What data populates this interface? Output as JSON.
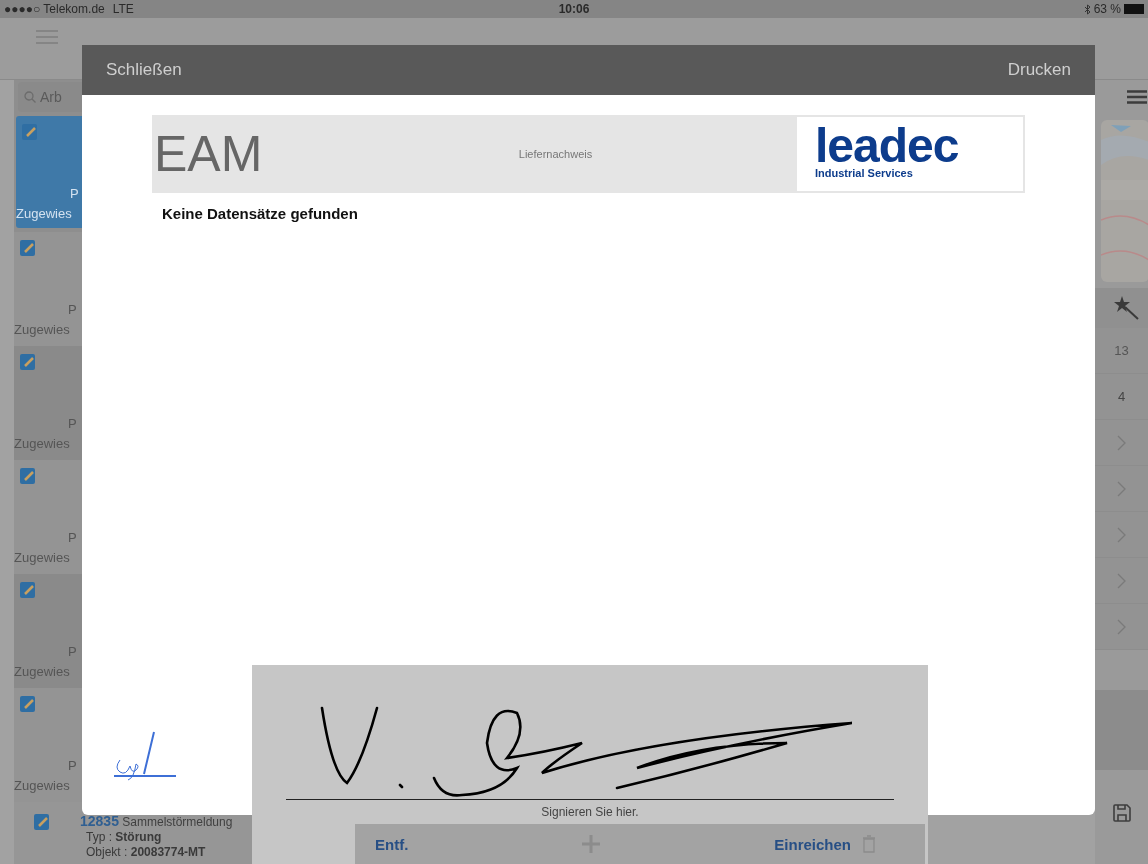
{
  "status_bar": {
    "carrier": "●●●●○ Telekom.de",
    "network": "LTE",
    "time": "10:06",
    "battery": "63 %"
  },
  "list": {
    "search_placeholder": "Arb",
    "items": [
      {
        "line_1": "P",
        "line_2": "Zugewies",
        "selected": true
      },
      {
        "line_1": "P",
        "line_2": "Zugewies",
        "selected": false
      },
      {
        "line_1": "P",
        "line_2": "Zugewies",
        "selected": false
      },
      {
        "line_1": "P",
        "line_2": "Zugewies",
        "selected": false
      },
      {
        "line_1": "P",
        "line_2": "Zugewies",
        "selected": false
      },
      {
        "line_1": "P",
        "line_2": "Zugewies",
        "selected": false
      }
    ],
    "last_item": {
      "number": "12835",
      "title": "Sammelstörmeldung",
      "type_label": "Typ :",
      "type": "Störung",
      "object_label": "Objekt :",
      "object": "20083774-MT"
    }
  },
  "right_panel": {
    "rows": [
      {
        "kind": "number",
        "value": "13"
      },
      {
        "kind": "number",
        "value": "4"
      },
      {
        "kind": "chevron"
      },
      {
        "kind": "chevron"
      },
      {
        "kind": "chevron"
      },
      {
        "kind": "chevron"
      },
      {
        "kind": "chevron"
      }
    ]
  },
  "toolbar": {
    "delete": "Entf.",
    "submit": "Einreichen"
  },
  "dialog": {
    "close": "Schließen",
    "print": "Drucken",
    "header": {
      "title": "EAM",
      "subtitle": "Liefernachweis",
      "logo_text": "leadec",
      "logo_tagline": "Industrial Services"
    },
    "message": "Keine Datensätze gefunden",
    "signature": {
      "hint": "Signieren Sie hier."
    }
  }
}
